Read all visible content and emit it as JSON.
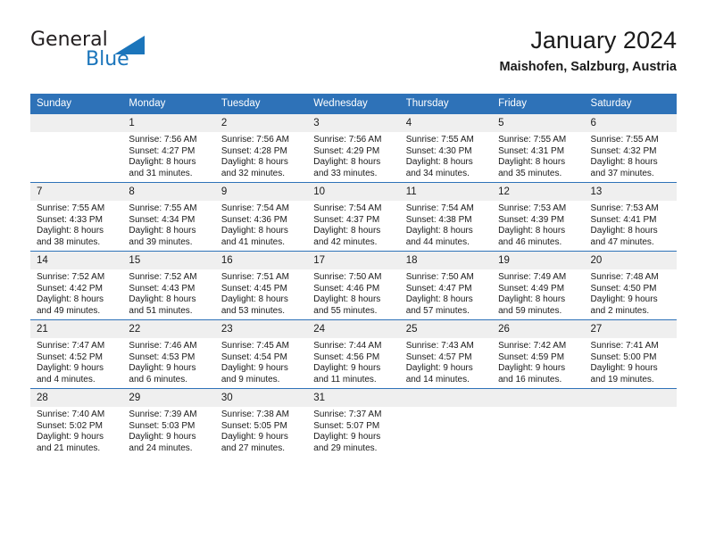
{
  "brand": {
    "word_one": "General",
    "word_two": "Blue",
    "logo_icon": "triangle-logo-icon",
    "accent_color": "#1b75bb"
  },
  "header": {
    "title": "January 2024",
    "subtitle": "Maishofen, Salzburg, Austria"
  },
  "theme": {
    "header_bg": "#2e72b8",
    "daynum_bg": "#efefef",
    "row_rule": "#2e72b8",
    "text": "#1a1a1a"
  },
  "calendar": {
    "weekday_headers": [
      "Sunday",
      "Monday",
      "Tuesday",
      "Wednesday",
      "Thursday",
      "Friday",
      "Saturday"
    ],
    "weeks": [
      [
        {
          "day": "",
          "sunrise": "",
          "sunset": "",
          "daylight_1": "",
          "daylight_2": ""
        },
        {
          "day": "1",
          "sunrise": "Sunrise: 7:56 AM",
          "sunset": "Sunset: 4:27 PM",
          "daylight_1": "Daylight: 8 hours",
          "daylight_2": "and 31 minutes."
        },
        {
          "day": "2",
          "sunrise": "Sunrise: 7:56 AM",
          "sunset": "Sunset: 4:28 PM",
          "daylight_1": "Daylight: 8 hours",
          "daylight_2": "and 32 minutes."
        },
        {
          "day": "3",
          "sunrise": "Sunrise: 7:56 AM",
          "sunset": "Sunset: 4:29 PM",
          "daylight_1": "Daylight: 8 hours",
          "daylight_2": "and 33 minutes."
        },
        {
          "day": "4",
          "sunrise": "Sunrise: 7:55 AM",
          "sunset": "Sunset: 4:30 PM",
          "daylight_1": "Daylight: 8 hours",
          "daylight_2": "and 34 minutes."
        },
        {
          "day": "5",
          "sunrise": "Sunrise: 7:55 AM",
          "sunset": "Sunset: 4:31 PM",
          "daylight_1": "Daylight: 8 hours",
          "daylight_2": "and 35 minutes."
        },
        {
          "day": "6",
          "sunrise": "Sunrise: 7:55 AM",
          "sunset": "Sunset: 4:32 PM",
          "daylight_1": "Daylight: 8 hours",
          "daylight_2": "and 37 minutes."
        }
      ],
      [
        {
          "day": "7",
          "sunrise": "Sunrise: 7:55 AM",
          "sunset": "Sunset: 4:33 PM",
          "daylight_1": "Daylight: 8 hours",
          "daylight_2": "and 38 minutes."
        },
        {
          "day": "8",
          "sunrise": "Sunrise: 7:55 AM",
          "sunset": "Sunset: 4:34 PM",
          "daylight_1": "Daylight: 8 hours",
          "daylight_2": "and 39 minutes."
        },
        {
          "day": "9",
          "sunrise": "Sunrise: 7:54 AM",
          "sunset": "Sunset: 4:36 PM",
          "daylight_1": "Daylight: 8 hours",
          "daylight_2": "and 41 minutes."
        },
        {
          "day": "10",
          "sunrise": "Sunrise: 7:54 AM",
          "sunset": "Sunset: 4:37 PM",
          "daylight_1": "Daylight: 8 hours",
          "daylight_2": "and 42 minutes."
        },
        {
          "day": "11",
          "sunrise": "Sunrise: 7:54 AM",
          "sunset": "Sunset: 4:38 PM",
          "daylight_1": "Daylight: 8 hours",
          "daylight_2": "and 44 minutes."
        },
        {
          "day": "12",
          "sunrise": "Sunrise: 7:53 AM",
          "sunset": "Sunset: 4:39 PM",
          "daylight_1": "Daylight: 8 hours",
          "daylight_2": "and 46 minutes."
        },
        {
          "day": "13",
          "sunrise": "Sunrise: 7:53 AM",
          "sunset": "Sunset: 4:41 PM",
          "daylight_1": "Daylight: 8 hours",
          "daylight_2": "and 47 minutes."
        }
      ],
      [
        {
          "day": "14",
          "sunrise": "Sunrise: 7:52 AM",
          "sunset": "Sunset: 4:42 PM",
          "daylight_1": "Daylight: 8 hours",
          "daylight_2": "and 49 minutes."
        },
        {
          "day": "15",
          "sunrise": "Sunrise: 7:52 AM",
          "sunset": "Sunset: 4:43 PM",
          "daylight_1": "Daylight: 8 hours",
          "daylight_2": "and 51 minutes."
        },
        {
          "day": "16",
          "sunrise": "Sunrise: 7:51 AM",
          "sunset": "Sunset: 4:45 PM",
          "daylight_1": "Daylight: 8 hours",
          "daylight_2": "and 53 minutes."
        },
        {
          "day": "17",
          "sunrise": "Sunrise: 7:50 AM",
          "sunset": "Sunset: 4:46 PM",
          "daylight_1": "Daylight: 8 hours",
          "daylight_2": "and 55 minutes."
        },
        {
          "day": "18",
          "sunrise": "Sunrise: 7:50 AM",
          "sunset": "Sunset: 4:47 PM",
          "daylight_1": "Daylight: 8 hours",
          "daylight_2": "and 57 minutes."
        },
        {
          "day": "19",
          "sunrise": "Sunrise: 7:49 AM",
          "sunset": "Sunset: 4:49 PM",
          "daylight_1": "Daylight: 8 hours",
          "daylight_2": "and 59 minutes."
        },
        {
          "day": "20",
          "sunrise": "Sunrise: 7:48 AM",
          "sunset": "Sunset: 4:50 PM",
          "daylight_1": "Daylight: 9 hours",
          "daylight_2": "and 2 minutes."
        }
      ],
      [
        {
          "day": "21",
          "sunrise": "Sunrise: 7:47 AM",
          "sunset": "Sunset: 4:52 PM",
          "daylight_1": "Daylight: 9 hours",
          "daylight_2": "and 4 minutes."
        },
        {
          "day": "22",
          "sunrise": "Sunrise: 7:46 AM",
          "sunset": "Sunset: 4:53 PM",
          "daylight_1": "Daylight: 9 hours",
          "daylight_2": "and 6 minutes."
        },
        {
          "day": "23",
          "sunrise": "Sunrise: 7:45 AM",
          "sunset": "Sunset: 4:54 PM",
          "daylight_1": "Daylight: 9 hours",
          "daylight_2": "and 9 minutes."
        },
        {
          "day": "24",
          "sunrise": "Sunrise: 7:44 AM",
          "sunset": "Sunset: 4:56 PM",
          "daylight_1": "Daylight: 9 hours",
          "daylight_2": "and 11 minutes."
        },
        {
          "day": "25",
          "sunrise": "Sunrise: 7:43 AM",
          "sunset": "Sunset: 4:57 PM",
          "daylight_1": "Daylight: 9 hours",
          "daylight_2": "and 14 minutes."
        },
        {
          "day": "26",
          "sunrise": "Sunrise: 7:42 AM",
          "sunset": "Sunset: 4:59 PM",
          "daylight_1": "Daylight: 9 hours",
          "daylight_2": "and 16 minutes."
        },
        {
          "day": "27",
          "sunrise": "Sunrise: 7:41 AM",
          "sunset": "Sunset: 5:00 PM",
          "daylight_1": "Daylight: 9 hours",
          "daylight_2": "and 19 minutes."
        }
      ],
      [
        {
          "day": "28",
          "sunrise": "Sunrise: 7:40 AM",
          "sunset": "Sunset: 5:02 PM",
          "daylight_1": "Daylight: 9 hours",
          "daylight_2": "and 21 minutes."
        },
        {
          "day": "29",
          "sunrise": "Sunrise: 7:39 AM",
          "sunset": "Sunset: 5:03 PM",
          "daylight_1": "Daylight: 9 hours",
          "daylight_2": "and 24 minutes."
        },
        {
          "day": "30",
          "sunrise": "Sunrise: 7:38 AM",
          "sunset": "Sunset: 5:05 PM",
          "daylight_1": "Daylight: 9 hours",
          "daylight_2": "and 27 minutes."
        },
        {
          "day": "31",
          "sunrise": "Sunrise: 7:37 AM",
          "sunset": "Sunset: 5:07 PM",
          "daylight_1": "Daylight: 9 hours",
          "daylight_2": "and 29 minutes."
        },
        {
          "day": "",
          "sunrise": "",
          "sunset": "",
          "daylight_1": "",
          "daylight_2": ""
        },
        {
          "day": "",
          "sunrise": "",
          "sunset": "",
          "daylight_1": "",
          "daylight_2": ""
        },
        {
          "day": "",
          "sunrise": "",
          "sunset": "",
          "daylight_1": "",
          "daylight_2": ""
        }
      ]
    ]
  }
}
